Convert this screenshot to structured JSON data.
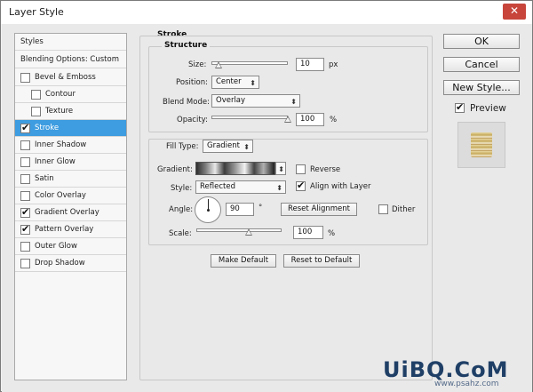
{
  "window": {
    "title": "Layer Style",
    "close_glyph": "✕"
  },
  "styles_panel": {
    "header": "Styles",
    "blending": "Blending Options: Custom",
    "items": [
      {
        "label": "Bevel & Emboss",
        "checked": false,
        "indent": 0
      },
      {
        "label": "Contour",
        "checked": false,
        "indent": 1
      },
      {
        "label": "Texture",
        "checked": false,
        "indent": 1
      },
      {
        "label": "Stroke",
        "checked": true,
        "indent": 0,
        "active": true
      },
      {
        "label": "Inner Shadow",
        "checked": false,
        "indent": 0
      },
      {
        "label": "Inner Glow",
        "checked": false,
        "indent": 0
      },
      {
        "label": "Satin",
        "checked": false,
        "indent": 0
      },
      {
        "label": "Color Overlay",
        "checked": false,
        "indent": 0
      },
      {
        "label": "Gradient Overlay",
        "checked": true,
        "indent": 0
      },
      {
        "label": "Pattern Overlay",
        "checked": true,
        "indent": 0
      },
      {
        "label": "Outer Glow",
        "checked": false,
        "indent": 0
      },
      {
        "label": "Drop Shadow",
        "checked": false,
        "indent": 0
      }
    ],
    "check_glyph": "✔"
  },
  "stroke": {
    "section_title": "Stroke",
    "structure_title": "Structure",
    "size_label": "Size:",
    "size_value": "10",
    "size_unit": "px",
    "size_slider_fraction": 0.05,
    "position_label": "Position:",
    "position_value": "Center",
    "blend_label": "Blend Mode:",
    "blend_value": "Overlay",
    "opacity_label": "Opacity:",
    "opacity_value": "100",
    "opacity_unit": "%",
    "opacity_slider_fraction": 1.0
  },
  "fill": {
    "filltype_label": "Fill Type:",
    "filltype_value": "Gradient",
    "gradient_label": "Gradient:",
    "reverse_label": "Reverse",
    "reverse_checked": false,
    "style_label": "Style:",
    "style_value": "Reflected",
    "align_label": "Align with Layer",
    "align_checked": true,
    "angle_label": "Angle:",
    "angle_value": "90",
    "angle_unit": "°",
    "reset_alignment": "Reset Alignment",
    "dither_label": "Dither",
    "dither_checked": false,
    "scale_label": "Scale:",
    "scale_value": "100",
    "scale_unit": "%",
    "scale_slider_fraction": 0.5
  },
  "footer_buttons": {
    "make_default": "Make Default",
    "reset_default": "Reset to Default"
  },
  "right_panel": {
    "ok": "OK",
    "cancel": "Cancel",
    "new_style": "New Style...",
    "preview_label": "Preview",
    "preview_checked": true
  },
  "watermark": {
    "main": "UiBQ.CoM",
    "sub": "www.psahz.com"
  },
  "dropdown_arrow": "⬍"
}
